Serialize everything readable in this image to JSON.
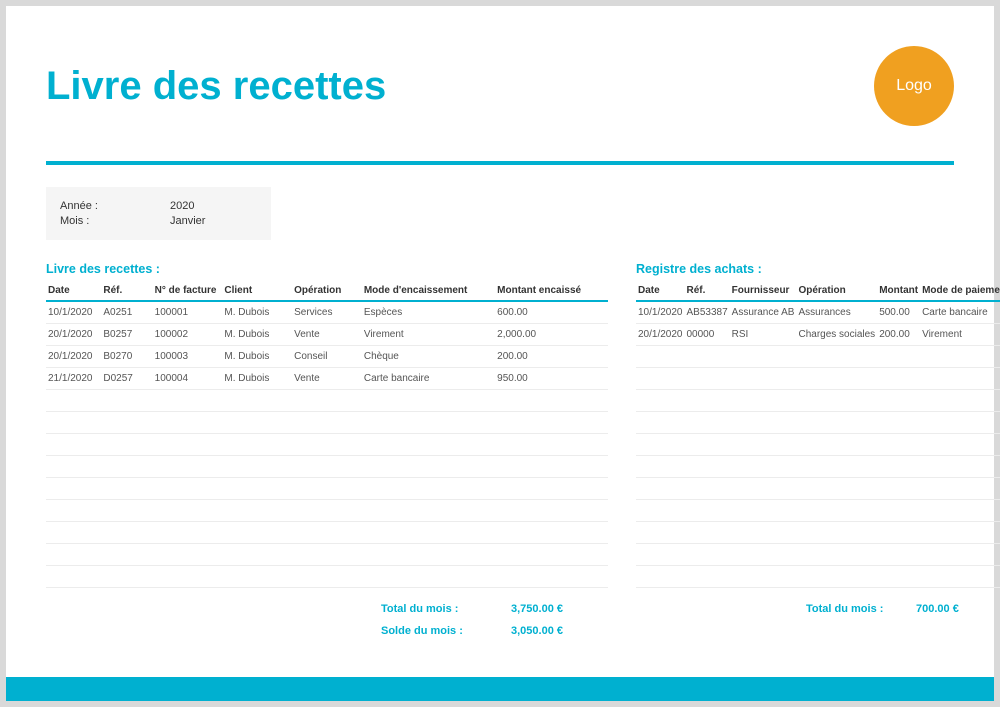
{
  "header": {
    "title": "Livre des recettes",
    "logo_text": "Logo"
  },
  "info": {
    "year_label": "Année :",
    "year_value": "2020",
    "month_label": "Mois :",
    "month_value": "Janvier"
  },
  "left": {
    "title": "Livre des recettes :",
    "headers": [
      "Date",
      "Réf.",
      "N° de facture",
      "Client",
      "Opération",
      "Mode d'encaissement",
      "Montant encaissé"
    ],
    "rows": [
      [
        "10/1/2020",
        "A0251",
        "100001",
        "M. Dubois",
        "Services",
        "Espèces",
        "600.00"
      ],
      [
        "20/1/2020",
        "B0257",
        "100002",
        "M. Dubois",
        "Vente",
        "Virement",
        "2,000.00"
      ],
      [
        "20/1/2020",
        "B0270",
        "100003",
        "M. Dubois",
        "Conseil",
        "Chèque",
        "200.00"
      ],
      [
        "21/1/2020",
        "D0257",
        "100004",
        "M. Dubois",
        "Vente",
        "Carte bancaire",
        "950.00"
      ]
    ],
    "empty_rows": 9,
    "totals": {
      "total_label": "Total du mois :",
      "total_value": "3,750.00 €",
      "balance_label": "Solde du mois :",
      "balance_value": "3,050.00 €"
    }
  },
  "right": {
    "title": "Registre des achats :",
    "headers": [
      "Date",
      "Réf.",
      "Fournisseur",
      "Opération",
      "Montant",
      "Mode de paiement"
    ],
    "rows": [
      [
        "10/1/2020",
        "AB53387",
        "Assurance AB",
        "Assurances",
        "500.00",
        "Carte bancaire"
      ],
      [
        "20/1/2020",
        "00000",
        "RSI",
        "Charges sociales",
        "200.00",
        "Virement"
      ]
    ],
    "empty_rows": 11,
    "totals": {
      "total_label": "Total du mois :",
      "total_value": "700.00 €"
    }
  }
}
